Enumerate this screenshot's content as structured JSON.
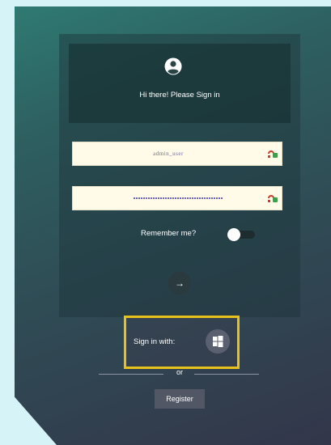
{
  "header": {
    "greeting": "Hi there! Please Sign in",
    "icon": "user-circle-icon"
  },
  "form": {
    "username_value": "admin_user",
    "password_masked": true,
    "field_badge_icon": "password-manager-icon",
    "remember_label": "Remember me?",
    "remember_on": false,
    "submit_icon": "arrow-right-icon"
  },
  "sso": {
    "label": "Sign in with:",
    "provider_icon": "windows-icon",
    "highlight_color": "#e8c21a"
  },
  "divider": {
    "text": "or"
  },
  "register": {
    "label": "Register"
  },
  "colors": {
    "page_bg": "#d6f3f8",
    "field_bg": "#fffbe8"
  }
}
